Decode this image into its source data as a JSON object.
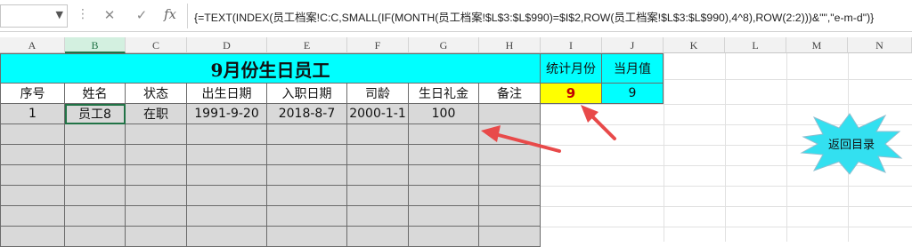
{
  "formula_bar": {
    "name_box": "",
    "cancel_icon": "✕",
    "confirm_icon": "✓",
    "fx_label": "fx",
    "formula": "{=TEXT(INDEX(员工档案!C:C,SMALL(IF(MONTH(员工档案!$L$3:$L$990)=$I$2,ROW(员工档案!$L$3:$L$990),4^8),ROW(2:2)))&\"\",\"e-m-d\")}"
  },
  "columns": [
    "A",
    "B",
    "C",
    "D",
    "E",
    "F",
    "G",
    "H",
    "I",
    "J",
    "K",
    "L",
    "M",
    "N"
  ],
  "sheet": {
    "title": "9月份生日员工",
    "headers": [
      "序号",
      "姓名",
      "状态",
      "出生日期",
      "入职日期",
      "司龄",
      "生日礼金",
      "备注"
    ],
    "row1": [
      "1",
      "员工8",
      "在职",
      "1991-9-20",
      "2018-8-7",
      "2000-1-1",
      "100",
      ""
    ],
    "stat_month_label": "统计月份",
    "current_value_label": "当月值",
    "stat_month_value": "9",
    "current_value": "9"
  },
  "return_button": "返回目录",
  "colors": {
    "cyan": "#00ffff",
    "gray_fill": "#d9d9d9",
    "yellow": "#ffff00",
    "arrow_red": "#e84a4a",
    "burst": "#33e0f0"
  }
}
